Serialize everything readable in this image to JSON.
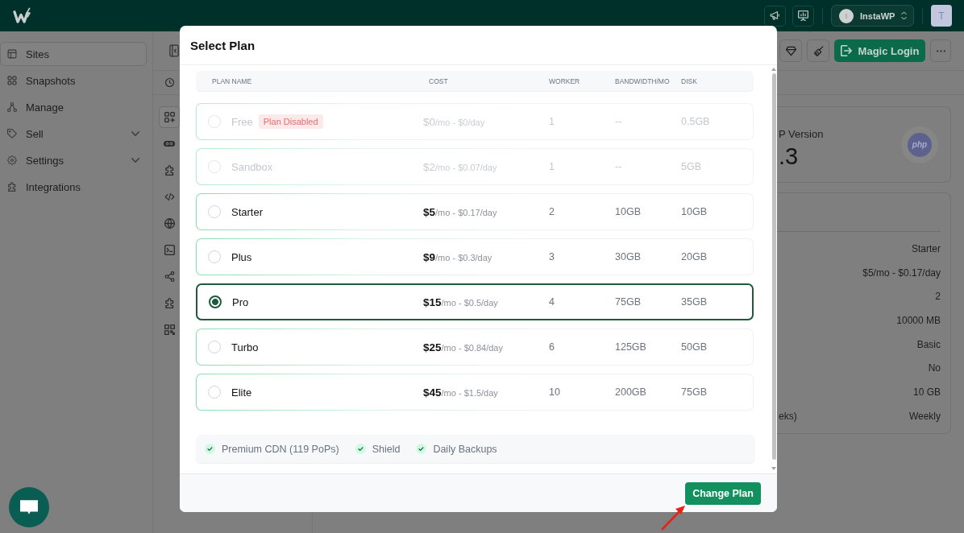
{
  "topbar": {
    "account": {
      "initial": "I",
      "name": "InstaWP"
    },
    "user_initial": "T"
  },
  "sidebar": {
    "items": [
      {
        "kind": "link",
        "label": "Sites",
        "selected": true
      },
      {
        "kind": "link",
        "label": "Snapshots",
        "selected": false
      },
      {
        "kind": "link",
        "label": "Manage",
        "selected": false
      },
      {
        "kind": "group",
        "label": "Sell",
        "selected": false
      },
      {
        "kind": "group",
        "label": "Settings",
        "selected": false
      },
      {
        "kind": "link",
        "label": "Integrations",
        "selected": false
      }
    ]
  },
  "tool_rail": {
    "items": [
      {
        "selected": true
      },
      {
        "selected": false
      },
      {
        "selected": false
      },
      {
        "selected": false
      },
      {
        "selected": false
      },
      {
        "selected": false
      },
      {
        "selected": false
      },
      {
        "selected": false
      },
      {
        "selected": false
      }
    ]
  },
  "site_toolbar": {
    "magic_login": "Magic Login"
  },
  "php_card": {
    "label": "P Version",
    "value": ".3",
    "logo": "php"
  },
  "details": {
    "rows": [
      {
        "value": "Starter"
      },
      {
        "value": "$5/mo - $0.17/day"
      },
      {
        "value": "2"
      },
      {
        "value": "10000 MB"
      },
      {
        "value": "Basic"
      },
      {
        "value": "No"
      },
      {
        "value": "10 GB"
      },
      {
        "label": "eks)",
        "value": "Weekly"
      }
    ]
  },
  "modal": {
    "title": "Select Plan",
    "columns": [
      "PLAN NAME",
      "COST",
      "WORKER",
      "BANDWIDTH/MO",
      "DISK"
    ],
    "plans": [
      {
        "name": "Free",
        "badge": "Plan Disabled",
        "disabled": true,
        "selected": false,
        "price": "**$0**/mo - $0/day",
        "worker": "1",
        "bandwidth": "--",
        "disk": "0.5GB"
      },
      {
        "name": "Sandbox",
        "disabled": true,
        "selected": false,
        "price": "**$2**/mo - $0.07/day",
        "worker": "1",
        "bandwidth": "--",
        "disk": "5GB"
      },
      {
        "name": "Starter",
        "disabled": false,
        "selected": false,
        "price": "**$5**/mo - $0.17/day",
        "worker": "2",
        "bandwidth": "10GB",
        "disk": "10GB"
      },
      {
        "name": "Plus",
        "disabled": false,
        "selected": false,
        "price": "**$9**/mo - $0.3/day",
        "worker": "3",
        "bandwidth": "30GB",
        "disk": "20GB"
      },
      {
        "name": "Pro",
        "disabled": false,
        "selected": true,
        "price": "**$15**/mo - $0.5/day",
        "worker": "4",
        "bandwidth": "75GB",
        "disk": "35GB"
      },
      {
        "name": "Turbo",
        "disabled": false,
        "selected": false,
        "price": "**$25**/mo - $0.84/day",
        "worker": "6",
        "bandwidth": "125GB",
        "disk": "50GB"
      },
      {
        "name": "Elite",
        "disabled": false,
        "selected": false,
        "price": "**$45**/mo - $1.5/day",
        "worker": "10",
        "bandwidth": "200GB",
        "disk": "75GB"
      }
    ],
    "features": [
      "Premium CDN (119 PoPs)",
      "Shield",
      "Daily Backups"
    ],
    "submit": "Change Plan"
  }
}
